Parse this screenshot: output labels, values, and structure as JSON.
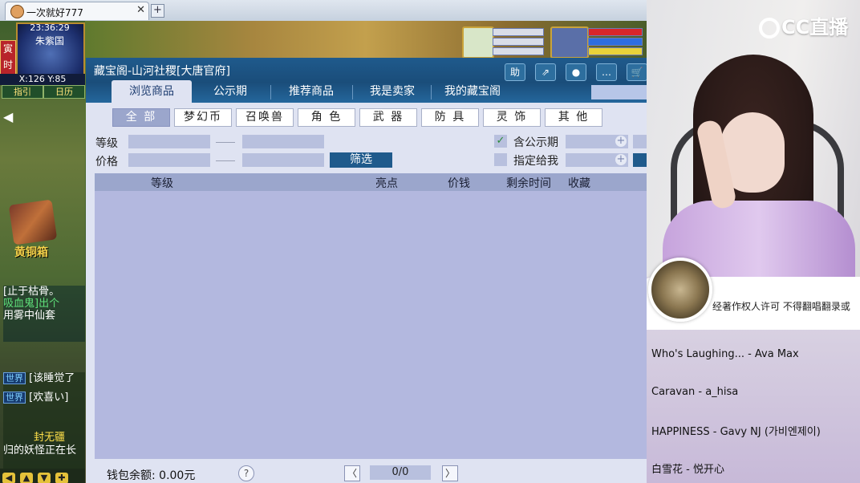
{
  "browser": {
    "tab_title": "一次就好777",
    "close": "✕",
    "new_tab": "+"
  },
  "hud": {
    "clock": "23:36:29",
    "map_name": "朱紫国",
    "time_badge": "寅时",
    "coords": "X:126 Y:85",
    "guide_label": "指引",
    "calendar_label": "日历",
    "box_label": "黄铜箱",
    "chat_top": [
      "[止于枯骨。",
      "吸血鬼]出个",
      "用雾中仙套"
    ],
    "chat_world_tag": "世界",
    "chat_lines": [
      "[该睡觉了",
      "[欢喜い]"
    ],
    "chat_bottom": [
      "封无疆",
      "归的妖怪正在长"
    ]
  },
  "dialog": {
    "title": "藏宝阁-山河社稷[大唐官府]",
    "toolbar": [
      "助",
      "⇗",
      "●",
      "…",
      "🛒"
    ],
    "tabs": [
      "浏览商品",
      "公示期",
      "推荐商品",
      "我是卖家",
      "我的藏宝阁"
    ],
    "active_tab": 0,
    "categories": [
      "全 部",
      "梦幻币",
      "召唤兽",
      "角 色",
      "武 器",
      "防 具",
      "灵 饰",
      "其 他"
    ],
    "active_category": 0,
    "level_label": "等级",
    "price_label": "价格",
    "filter_button": "筛选",
    "include_public_label": "含公示期",
    "include_public_checked": "✓",
    "assigned_label": "指定给我",
    "columns": [
      "等级",
      "亮点",
      "价钱",
      "剩余时间",
      "收藏"
    ],
    "wallet": "钱包余额: 0.00元",
    "help": "?",
    "prev": "〈",
    "page": "0/0",
    "next": "〉"
  },
  "stream": {
    "logo": "CC直播",
    "notice": "经著作权人许可 不得翻唱翻录或",
    "songs": [
      "Who's Laughing...   - Ava Max",
      "Caravan - a_hisa",
      "HAPPINESS - Gavy NJ (가비엔제이)",
      "白雪花 - 悦开心"
    ]
  }
}
